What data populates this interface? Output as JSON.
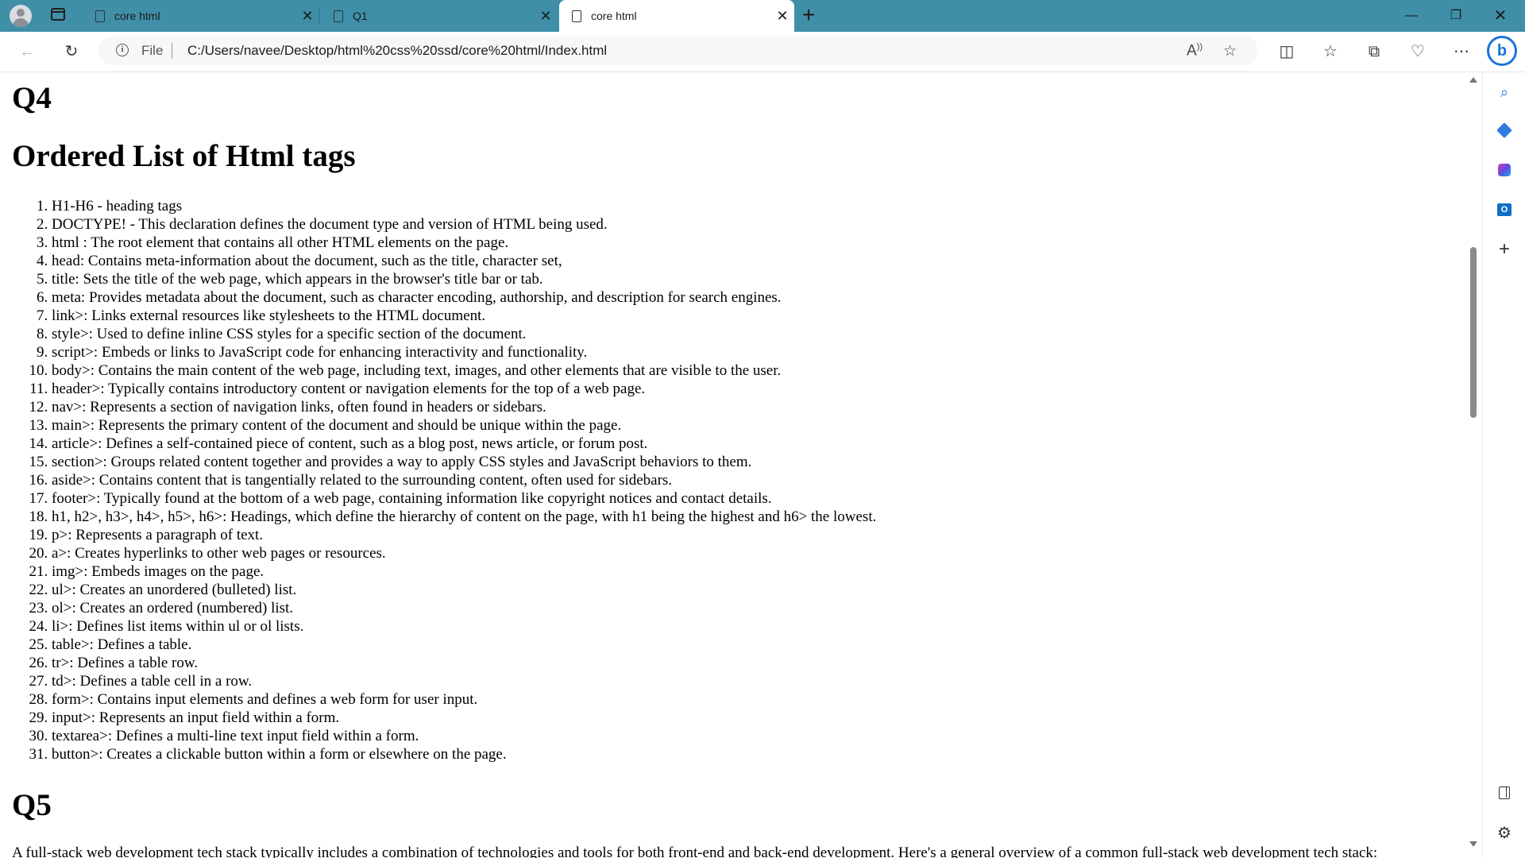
{
  "browser": {
    "tabs": [
      {
        "title": "core html",
        "active": false
      },
      {
        "title": "Q1",
        "active": false
      },
      {
        "title": "core html",
        "active": true
      }
    ],
    "address": {
      "scheme_label": "File",
      "url": "C:/Users/navee/Desktop/html%20css%20ssd/core%20html/Index.html"
    },
    "colors": {
      "tabstrip": "#3f8fa8",
      "accent": "#1a73d9"
    },
    "icons": {
      "back": "arrow-left-icon",
      "refresh": "refresh-icon",
      "read_aloud": "read-aloud-icon",
      "favorite": "star-icon",
      "split": "split-screen-icon",
      "favorites": "favorites-icon",
      "collections": "collections-icon",
      "performance": "heart-pulse-icon",
      "more": "more-icon",
      "copilot": "bing-icon"
    }
  },
  "page": {
    "q4_heading": "Q4",
    "list_title": "Ordered List of Html tags",
    "items": [
      "H1-H6 - heading tags",
      "DOCTYPE! - This declaration defines the document type and version of HTML being used.",
      "html : The root element that contains all other HTML elements on the page.",
      "head: Contains meta-information about the document, such as the title, character set,",
      "title: Sets the title of the web page, which appears in the browser's title bar or tab.",
      "meta: Provides metadata about the document, such as character encoding, authorship, and description for search engines.",
      "link>: Links external resources like stylesheets to the HTML document.",
      "style>: Used to define inline CSS styles for a specific section of the document.",
      "script>: Embeds or links to JavaScript code for enhancing interactivity and functionality.",
      "body>: Contains the main content of the web page, including text, images, and other elements that are visible to the user.",
      "header>: Typically contains introductory content or navigation elements for the top of a web page.",
      "nav>: Represents a section of navigation links, often found in headers or sidebars.",
      "main>: Represents the primary content of the document and should be unique within the page.",
      "article>: Defines a self-contained piece of content, such as a blog post, news article, or forum post.",
      "section>: Groups related content together and provides a way to apply CSS styles and JavaScript behaviors to them.",
      "aside>: Contains content that is tangentially related to the surrounding content, often used for sidebars.",
      "footer>: Typically found at the bottom of a web page, containing information like copyright notices and contact details.",
      "h1, h2>, h3>, h4>, h5>, h6>: Headings, which define the hierarchy of content on the page, with h1 being the highest and h6> the lowest.",
      "p>: Represents a paragraph of text.",
      "a>: Creates hyperlinks to other web pages or resources.",
      "img>: Embeds images on the page.",
      "ul>: Creates an unordered (bulleted) list.",
      "ol>: Creates an ordered (numbered) list.",
      "li>: Defines list items within ul or ol lists.",
      "table>: Defines a table.",
      "tr>: Defines a table row.",
      "td>: Defines a table cell in a row.",
      "form>: Contains input elements and defines a web form for user input.",
      "input>: Represents an input field within a form.",
      "textarea>: Defines a multi-line text input field within a form.",
      "button>: Creates a clickable button within a form or elsewhere on the page."
    ],
    "q5_heading": "Q5",
    "q5_paragraph": "A full-stack web development tech stack typically includes a combination of technologies and tools for both front-end and back-end development. Here's a general overview of a common full-stack web development tech stack:"
  }
}
